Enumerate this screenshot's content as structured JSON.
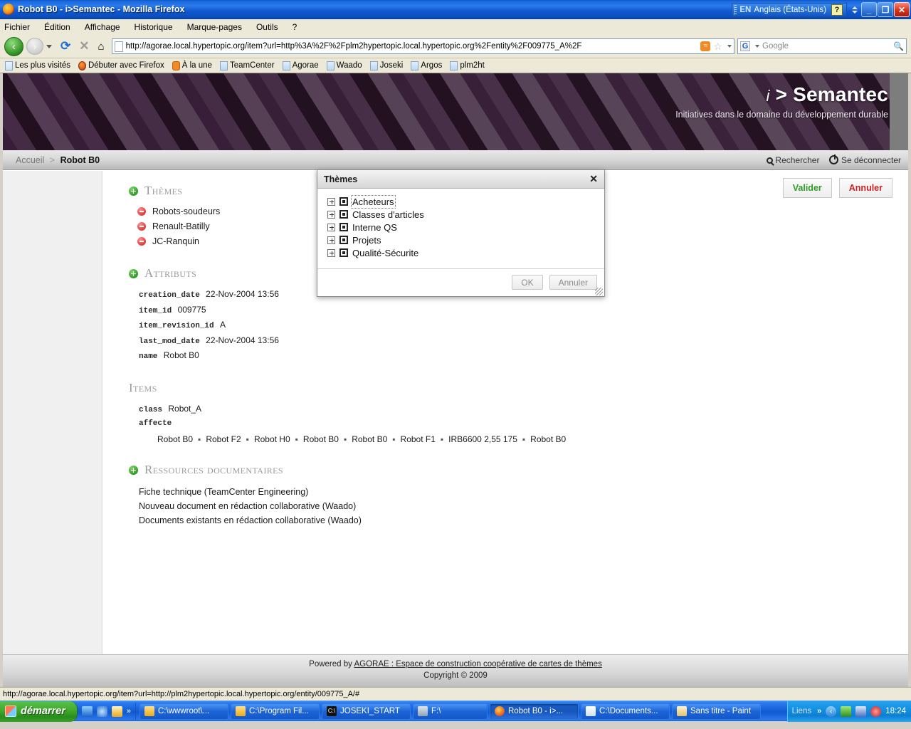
{
  "window": {
    "title": "Robot B0 - i>Semantec - Mozilla Firefox",
    "language_indicator": {
      "code": "EN",
      "label": "Anglais (États-Unis)",
      "help": "?"
    },
    "buttons": {
      "minimize": "_",
      "restore": "❐",
      "close": "✕"
    }
  },
  "menubar": [
    {
      "label": "Fichier"
    },
    {
      "label": "Édition"
    },
    {
      "label": "Affichage"
    },
    {
      "label": "Historique"
    },
    {
      "label": "Marque-pages"
    },
    {
      "label": "Outils"
    },
    {
      "label": "?"
    }
  ],
  "navbar": {
    "back": "‹",
    "forward": "›",
    "reload": "⟳",
    "stop": "✕",
    "home": "⌂",
    "url": "http://agorae.local.hypertopic.org/item?url=http%3A%2F%2Fplm2hypertopic.local.hypertopic.org%2Fentity%2F009775_A%2F",
    "rss_icon": "rss-icon",
    "bookmark_star": "☆",
    "search_engine": "G",
    "search_placeholder": "Google"
  },
  "bookmarks": [
    {
      "label": "Les plus visités",
      "icon": "visited-icon"
    },
    {
      "label": "Débuter avec Firefox",
      "icon": "firefox-icon"
    },
    {
      "label": "À la une",
      "icon": "rss-icon"
    },
    {
      "label": "TeamCenter",
      "icon": "page-icon"
    },
    {
      "label": "Agorae",
      "icon": "page-icon"
    },
    {
      "label": "Waado",
      "icon": "page-icon"
    },
    {
      "label": "Joseki",
      "icon": "page-icon"
    },
    {
      "label": "Argos",
      "icon": "page-icon"
    },
    {
      "label": "plm2ht",
      "icon": "page-icon"
    }
  ],
  "banner": {
    "brand_prefix": "i",
    "brand_sep": ">",
    "brand_name": "Semantec",
    "tagline": "Initiatives dans le domaine du développement durable"
  },
  "crumbbar": {
    "home": "Accueil",
    "separator": ">",
    "current": "Robot B0",
    "search_label": "Rechercher",
    "logout_label": "Se déconnecter"
  },
  "page_actions": {
    "validate": "Valider",
    "cancel": "Annuler"
  },
  "sections": {
    "themes": {
      "title": "Thèmes",
      "items": [
        {
          "label": "Robots-soudeurs"
        },
        {
          "label": "Renault-Batilly"
        },
        {
          "label": "JC-Ranquin"
        }
      ]
    },
    "attributs": {
      "title": "Attributs",
      "rows": [
        {
          "key": "creation_date",
          "value": "22-Nov-2004 13:56"
        },
        {
          "key": "item_id",
          "value": "009775"
        },
        {
          "key": "item_revision_id",
          "value": "A"
        },
        {
          "key": "last_mod_date",
          "value": "22-Nov-2004 13:56"
        },
        {
          "key": "name",
          "value": "Robot B0"
        }
      ]
    },
    "items": {
      "title": "Items",
      "class_key": "class",
      "class_value": "Robot_A",
      "affecte_key": "affecte",
      "affecte_values": [
        "Robot B0",
        "Robot F2",
        "Robot H0",
        "Robot B0",
        "Robot B0",
        "Robot F1",
        "IRB6600 2,55 175",
        "Robot B0"
      ]
    },
    "ressources": {
      "title": "Ressources documentaires",
      "links": [
        {
          "label": "Fiche technique (TeamCenter Engineering)"
        },
        {
          "label": "Nouveau document en rédaction collaborative (Waado)"
        },
        {
          "label": "Documents existants en rédaction collaborative (Waado)"
        }
      ]
    }
  },
  "page_footer": {
    "powered_prefix": "Powered by ",
    "powered_link": "AGORAE : Espace de construction coopérative de cartes de thèmes",
    "copyright": "Copyright © 2009"
  },
  "dialog": {
    "title": "Thèmes",
    "close": "✕",
    "tree": [
      {
        "label": "Acheteurs",
        "selected": true
      },
      {
        "label": "Classes d'articles",
        "selected": false
      },
      {
        "label": "Interne QS",
        "selected": false
      },
      {
        "label": "Projets",
        "selected": false
      },
      {
        "label": "Qualité-Sécurite",
        "selected": false
      }
    ],
    "ok": "OK",
    "cancel": "Annuler"
  },
  "statusbar": {
    "url": "http://agorae.local.hypertopic.org/item?url=http://plm2hypertopic.local.hypertopic.org/entity/009775_A/#"
  },
  "taskbar": {
    "start": "démarrer",
    "quicklaunch_chevron": "»",
    "tasks": [
      {
        "label": "C:\\wwwroot\\...",
        "icon": "folder-icon",
        "active": false
      },
      {
        "label": "C:\\Program Fil...",
        "icon": "folder-icon",
        "active": false
      },
      {
        "label": "JOSEKI_START",
        "icon": "console-icon",
        "active": false
      },
      {
        "label": "F:\\",
        "icon": "drive-icon",
        "active": false
      },
      {
        "label": "Robot B0 - i>...",
        "icon": "firefox-icon",
        "active": true
      },
      {
        "label": "C:\\Documents...",
        "icon": "notepad-icon",
        "active": false
      },
      {
        "label": "Sans titre - Paint",
        "icon": "paint-icon",
        "active": false
      }
    ],
    "tray_label": "Liens",
    "tray_chevron": "»",
    "clock": "18:24"
  },
  "colors": {
    "titlebar_blue": "#1158cf",
    "banner_purple": "#5a3a5a",
    "accent_green": "#2f9c27",
    "accent_red": "#cc2222",
    "section_grey": "#9b9b9b"
  }
}
